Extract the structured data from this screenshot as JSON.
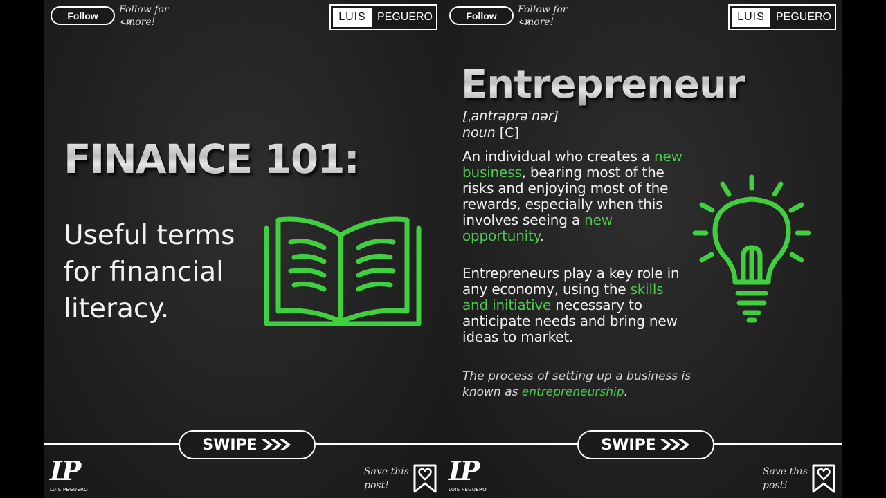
{
  "colors": {
    "accent_green": "#4cc94c",
    "background": "#222222",
    "text": "#ffffff"
  },
  "left_panel": {
    "follow_button": "Follow",
    "follow_note_line1": "Follow for",
    "follow_note_line2": "more!",
    "brand_first": "LUIS",
    "brand_last": "PEGUERO",
    "title": "FINANCE 101:",
    "subtitle": "Useful terms for financial literacy.",
    "icon": "open-book-icon",
    "swipe_label": "SWIPE",
    "logo_monogram": "LP",
    "logo_name": "LUIS PEGUERO",
    "save_note_line1": "Save this",
    "save_note_line2": "post!",
    "save_icon": "bookmark-heart-icon"
  },
  "right_panel": {
    "follow_button": "Follow",
    "follow_note_line1": "Follow for",
    "follow_note_line2": "more!",
    "brand_first": "LUIS",
    "brand_last": "PEGUERO",
    "term": "Entrepreneur",
    "pronunciation": "[ˌantrəprəˈnər]",
    "part_of_speech": "noun",
    "grammar_code": "[C]",
    "definition_1": {
      "t1": "An individual who creates a ",
      "h1": "new business",
      "t2": ", bearing most of the risks and enjoying most of the rewards, especially when this involves seeing a ",
      "h2": "new opportunity",
      "t3": "."
    },
    "definition_2": {
      "t1": "Entrepreneurs play a key role in any economy, using the ",
      "h1": "skills and initiative",
      "t2": " necessary to anticipate needs and bring new ideas to market."
    },
    "note": {
      "t1": "The process of setting up a business is known as ",
      "h1": "entrepreneurship",
      "t2": "."
    },
    "icon": "lightbulb-icon",
    "swipe_label": "SWIPE",
    "logo_monogram": "LP",
    "logo_name": "LUIS PEGUERO",
    "save_note_line1": "Save this",
    "save_note_line2": "post!",
    "save_icon": "bookmark-heart-icon"
  }
}
